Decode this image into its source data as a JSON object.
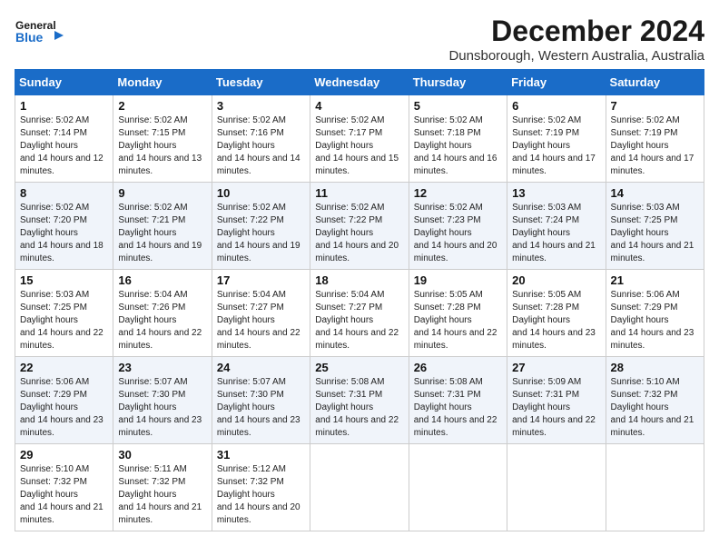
{
  "header": {
    "logo_line1": "General",
    "logo_line2": "Blue",
    "month": "December 2024",
    "location": "Dunsborough, Western Australia, Australia"
  },
  "weekdays": [
    "Sunday",
    "Monday",
    "Tuesday",
    "Wednesday",
    "Thursday",
    "Friday",
    "Saturday"
  ],
  "weeks": [
    [
      {
        "day": "1",
        "rise": "5:02 AM",
        "set": "7:14 PM",
        "daylight": "14 hours and 12 minutes."
      },
      {
        "day": "2",
        "rise": "5:02 AM",
        "set": "7:15 PM",
        "daylight": "14 hours and 13 minutes."
      },
      {
        "day": "3",
        "rise": "5:02 AM",
        "set": "7:16 PM",
        "daylight": "14 hours and 14 minutes."
      },
      {
        "day": "4",
        "rise": "5:02 AM",
        "set": "7:17 PM",
        "daylight": "14 hours and 15 minutes."
      },
      {
        "day": "5",
        "rise": "5:02 AM",
        "set": "7:18 PM",
        "daylight": "14 hours and 16 minutes."
      },
      {
        "day": "6",
        "rise": "5:02 AM",
        "set": "7:19 PM",
        "daylight": "14 hours and 17 minutes."
      },
      {
        "day": "7",
        "rise": "5:02 AM",
        "set": "7:19 PM",
        "daylight": "14 hours and 17 minutes."
      }
    ],
    [
      {
        "day": "8",
        "rise": "5:02 AM",
        "set": "7:20 PM",
        "daylight": "14 hours and 18 minutes."
      },
      {
        "day": "9",
        "rise": "5:02 AM",
        "set": "7:21 PM",
        "daylight": "14 hours and 19 minutes."
      },
      {
        "day": "10",
        "rise": "5:02 AM",
        "set": "7:22 PM",
        "daylight": "14 hours and 19 minutes."
      },
      {
        "day": "11",
        "rise": "5:02 AM",
        "set": "7:22 PM",
        "daylight": "14 hours and 20 minutes."
      },
      {
        "day": "12",
        "rise": "5:02 AM",
        "set": "7:23 PM",
        "daylight": "14 hours and 20 minutes."
      },
      {
        "day": "13",
        "rise": "5:03 AM",
        "set": "7:24 PM",
        "daylight": "14 hours and 21 minutes."
      },
      {
        "day": "14",
        "rise": "5:03 AM",
        "set": "7:25 PM",
        "daylight": "14 hours and 21 minutes."
      }
    ],
    [
      {
        "day": "15",
        "rise": "5:03 AM",
        "set": "7:25 PM",
        "daylight": "14 hours and 22 minutes."
      },
      {
        "day": "16",
        "rise": "5:04 AM",
        "set": "7:26 PM",
        "daylight": "14 hours and 22 minutes."
      },
      {
        "day": "17",
        "rise": "5:04 AM",
        "set": "7:27 PM",
        "daylight": "14 hours and 22 minutes."
      },
      {
        "day": "18",
        "rise": "5:04 AM",
        "set": "7:27 PM",
        "daylight": "14 hours and 22 minutes."
      },
      {
        "day": "19",
        "rise": "5:05 AM",
        "set": "7:28 PM",
        "daylight": "14 hours and 22 minutes."
      },
      {
        "day": "20",
        "rise": "5:05 AM",
        "set": "7:28 PM",
        "daylight": "14 hours and 23 minutes."
      },
      {
        "day": "21",
        "rise": "5:06 AM",
        "set": "7:29 PM",
        "daylight": "14 hours and 23 minutes."
      }
    ],
    [
      {
        "day": "22",
        "rise": "5:06 AM",
        "set": "7:29 PM",
        "daylight": "14 hours and 23 minutes."
      },
      {
        "day": "23",
        "rise": "5:07 AM",
        "set": "7:30 PM",
        "daylight": "14 hours and 23 minutes."
      },
      {
        "day": "24",
        "rise": "5:07 AM",
        "set": "7:30 PM",
        "daylight": "14 hours and 23 minutes."
      },
      {
        "day": "25",
        "rise": "5:08 AM",
        "set": "7:31 PM",
        "daylight": "14 hours and 22 minutes."
      },
      {
        "day": "26",
        "rise": "5:08 AM",
        "set": "7:31 PM",
        "daylight": "14 hours and 22 minutes."
      },
      {
        "day": "27",
        "rise": "5:09 AM",
        "set": "7:31 PM",
        "daylight": "14 hours and 22 minutes."
      },
      {
        "day": "28",
        "rise": "5:10 AM",
        "set": "7:32 PM",
        "daylight": "14 hours and 21 minutes."
      }
    ],
    [
      {
        "day": "29",
        "rise": "5:10 AM",
        "set": "7:32 PM",
        "daylight": "14 hours and 21 minutes."
      },
      {
        "day": "30",
        "rise": "5:11 AM",
        "set": "7:32 PM",
        "daylight": "14 hours and 21 minutes."
      },
      {
        "day": "31",
        "rise": "5:12 AM",
        "set": "7:32 PM",
        "daylight": "14 hours and 20 minutes."
      },
      null,
      null,
      null,
      null
    ]
  ]
}
